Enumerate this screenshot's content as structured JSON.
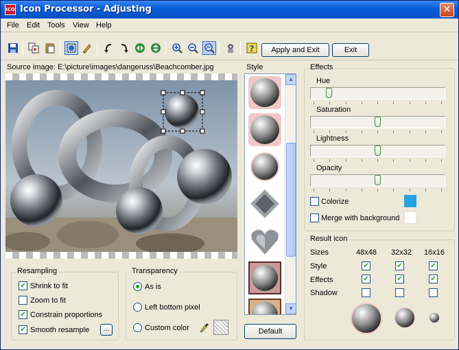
{
  "window": {
    "title": "Icon Processor - Adjusting",
    "icon_text": "ICO",
    "close_glyph": "✕"
  },
  "menu": {
    "file": "File",
    "edit": "Edit",
    "tools": "Tools",
    "view": "View",
    "help": "Help"
  },
  "toolbar": {
    "apply_exit_label": "Apply and Exit",
    "exit_label": "Exit"
  },
  "source": {
    "label": "Source image: E:\\picture\\images\\dangeruss\\Beachcomber.jpg"
  },
  "style_panel": {
    "label": "Style",
    "default_label": "Default"
  },
  "resampling": {
    "title": "Resampling",
    "shrink_to_fit": "Shrink to fit",
    "shrink_checked": true,
    "zoom_to_fit": "Zoom to fit",
    "zoom_checked": false,
    "constrain": "Constrain proportions",
    "constrain_checked": true,
    "smooth": "Smooth resample",
    "smooth_checked": true,
    "more_label": "..."
  },
  "transparency": {
    "title": "Transparency",
    "as_is": "As is",
    "left_bottom": "Left bottom pixel",
    "custom": "Custom color",
    "selected": "as_is"
  },
  "effects": {
    "title": "Effects",
    "hue_label": "Hue",
    "hue_value": 0.12,
    "saturation_label": "Saturation",
    "saturation_value": 0.5,
    "lightness_label": "Lightness",
    "lightness_value": 0.5,
    "opacity_label": "Opacity",
    "opacity_value": 0.5,
    "colorize_label": "Colorize",
    "colorize_checked": false,
    "colorize_color": "#29a3e0",
    "merge_label": "Merge with background",
    "merge_checked": false,
    "merge_color": "#ffffff"
  },
  "result": {
    "title": "Result icon",
    "sizes_label": "Sizes",
    "size_48": "48x48",
    "size_32": "32x32",
    "size_16": "16x16",
    "style_label": "Style",
    "effects_label": "Effects",
    "shadow_label": "Shadow"
  },
  "colors": {
    "title_blue": "#0a5fd9",
    "check_green": "#21a121",
    "window_bg": "#ece9d8"
  }
}
